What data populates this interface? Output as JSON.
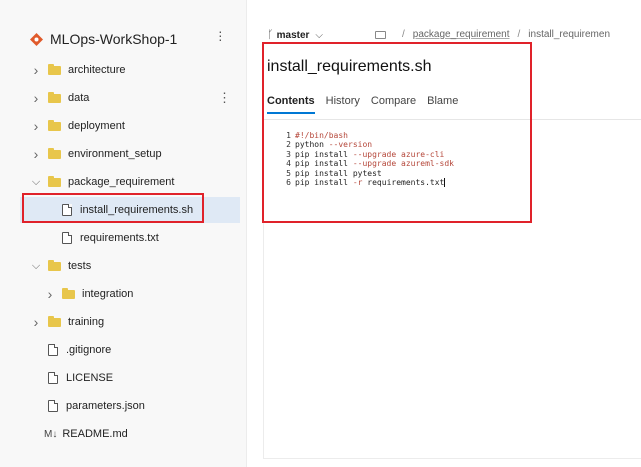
{
  "repo": {
    "name": "MLOps-WorkShop-1",
    "more": "⋮",
    "icon_color": "#e05a2b"
  },
  "tree": [
    {
      "label": "architecture",
      "type": "folder",
      "expanded": false,
      "depth": 0
    },
    {
      "label": "data",
      "type": "folder",
      "expanded": false,
      "depth": 0,
      "more": "⋮"
    },
    {
      "label": "deployment",
      "type": "folder",
      "expanded": false,
      "depth": 0
    },
    {
      "label": "environment_setup",
      "type": "folder",
      "expanded": false,
      "depth": 0
    },
    {
      "label": "package_requirement",
      "type": "folder",
      "expanded": true,
      "depth": 0
    },
    {
      "label": "install_requirements.sh",
      "type": "file",
      "depth": 1,
      "selected": true
    },
    {
      "label": "requirements.txt",
      "type": "file",
      "depth": 1
    },
    {
      "label": "tests",
      "type": "folder",
      "expanded": true,
      "depth": 0
    },
    {
      "label": "integration",
      "type": "folder",
      "expanded": false,
      "depth": 1
    },
    {
      "label": "training",
      "type": "folder",
      "expanded": false,
      "depth": 0
    },
    {
      "label": ".gitignore",
      "type": "file",
      "depth": 0
    },
    {
      "label": "LICENSE",
      "type": "file",
      "depth": 0
    },
    {
      "label": "parameters.json",
      "type": "file",
      "depth": 0
    },
    {
      "label": "README.md",
      "type": "markdown",
      "depth": 0,
      "icon_text": "M↓"
    }
  ],
  "header": {
    "branch": "master",
    "breadcrumb": [
      "package_requirement",
      "install_requiremen"
    ],
    "separator": "/"
  },
  "file": {
    "title": "install_requirements.sh"
  },
  "tabs": [
    {
      "label": "Contents",
      "active": true
    },
    {
      "label": "History",
      "active": false
    },
    {
      "label": "Compare",
      "active": false
    },
    {
      "label": "Blame",
      "active": false
    }
  ],
  "code": {
    "lines": [
      {
        "n": "1",
        "text": "#!/bin/bash"
      },
      {
        "n": "2",
        "text": "python --version"
      },
      {
        "n": "3",
        "text": "pip install --upgrade azure-cli"
      },
      {
        "n": "4",
        "text": "pip install --upgrade azureml-sdk"
      },
      {
        "n": "5",
        "text": "pip install pytest"
      },
      {
        "n": "6",
        "text": "pip install -r requirements.txt"
      }
    ]
  },
  "colors": {
    "highlight_box": "#e0222a",
    "accent": "#0078d4",
    "folder": "#e8c64b",
    "selected_row": "#dfe9f5"
  }
}
